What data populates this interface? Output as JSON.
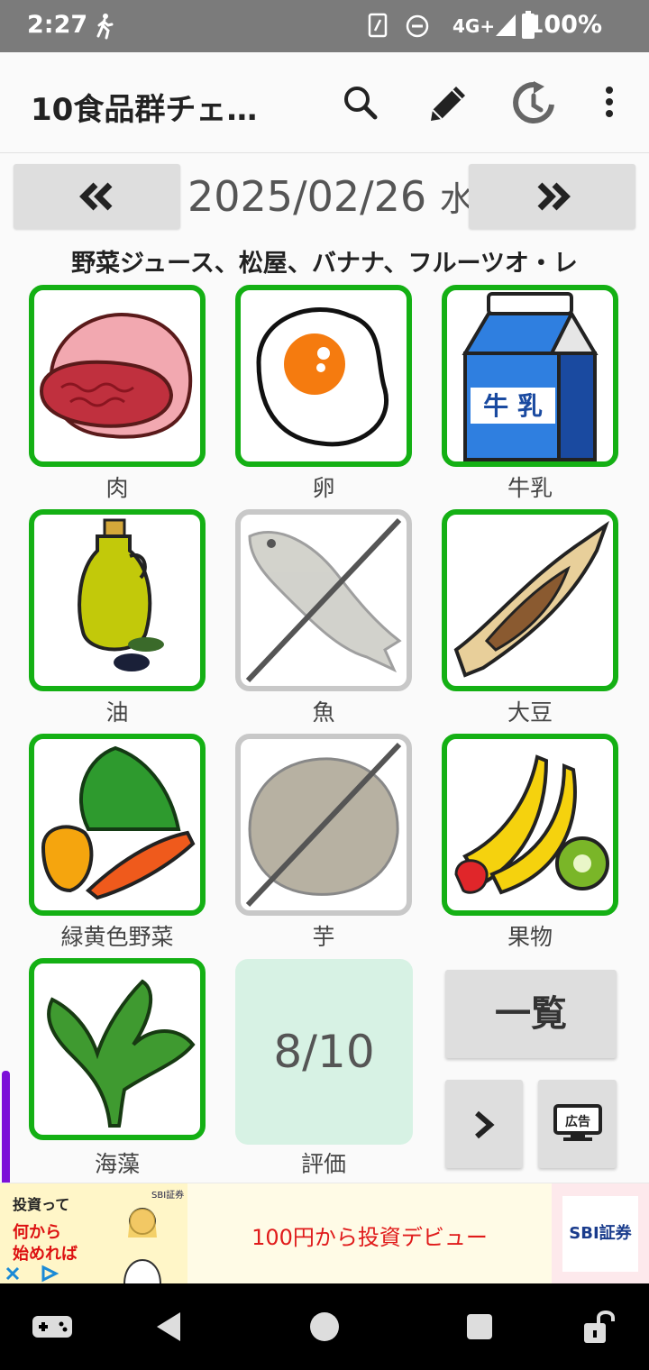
{
  "status_bar": {
    "time": "2:27",
    "network": "4G+",
    "battery": "100%",
    "icons": [
      "walk-icon",
      "nfc-icon",
      "dnd-icon",
      "signal-icon",
      "battery-icon"
    ]
  },
  "toolbar": {
    "title": "10食品群チェ…",
    "icons": [
      "search-icon",
      "pencil-icon",
      "history-icon",
      "more-vert-icon"
    ]
  },
  "date_nav": {
    "prev_label": "«",
    "next_label": "»",
    "date": "2025/02/26",
    "weekday": "水"
  },
  "memo": "野菜ジュース、松屋、バナナ、フルーツオ・レ",
  "food_groups": [
    {
      "label": "肉",
      "checked": true,
      "icon": "meat-icon"
    },
    {
      "label": "卵",
      "checked": true,
      "icon": "fried-egg-icon"
    },
    {
      "label": "牛乳",
      "checked": true,
      "icon": "milk-carton-icon",
      "icon_text": "牛 乳"
    },
    {
      "label": "油",
      "checked": true,
      "icon": "olive-oil-icon"
    },
    {
      "label": "魚",
      "checked": false,
      "icon": "fish-icon"
    },
    {
      "label": "大豆",
      "checked": true,
      "icon": "natto-icon"
    },
    {
      "label": "緑黄色野菜",
      "checked": true,
      "icon": "vegetables-icon"
    },
    {
      "label": "芋",
      "checked": false,
      "icon": "potato-icon"
    },
    {
      "label": "果物",
      "checked": true,
      "icon": "fruits-icon"
    },
    {
      "label": "海藻",
      "checked": true,
      "icon": "seaweed-icon"
    }
  ],
  "score": {
    "value": "8/10",
    "label": "評価"
  },
  "buttons": {
    "list_label": "一覧",
    "ad_button_label": "広告"
  },
  "ad": {
    "image_text_1": "投資って",
    "image_text_2": "何から",
    "image_text_3": "始めれば",
    "image_text_4": "SBI証券",
    "headline": "100円から投資デビュー",
    "logo_text": "SBI証券"
  },
  "colors": {
    "checked_border": "#14b014",
    "unchecked_border": "#c8c8c8",
    "score_bg": "#d7f2e4"
  }
}
